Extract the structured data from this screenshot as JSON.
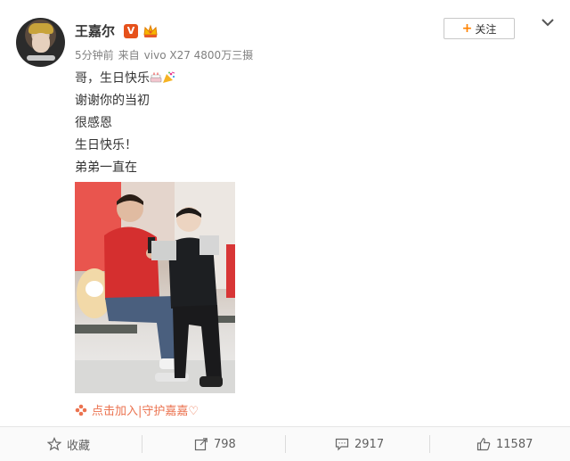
{
  "post": {
    "author": "王嘉尔",
    "vip_badge": "V",
    "time": "5分钟前",
    "source_prefix": "来自",
    "source": "vivo X27 4800万三摄",
    "lines": [
      "哥，生日快乐",
      "谢谢你的当初",
      "很感恩",
      "生日快乐！",
      "弟弟一直在"
    ],
    "photo_link": "点击加入|守护嘉嘉♡"
  },
  "follow": {
    "plus": "+",
    "label": "关注"
  },
  "actions": {
    "favorite_label": "收藏",
    "repost_count": "798",
    "comment_count": "2917",
    "like_count": "11587"
  },
  "colors": {
    "accent_orange": "#ff8200",
    "vip_red": "#e6511b",
    "link_orange": "#eb7350",
    "muted_text": "#808080"
  },
  "icons": [
    "avatar",
    "vip-icon",
    "crown-icon",
    "chevron-down-icon",
    "cake-emoji-icon",
    "party-popper-emoji-icon",
    "star-icon",
    "repost-icon",
    "comment-icon",
    "thumbs-up-icon",
    "flower-icon"
  ]
}
